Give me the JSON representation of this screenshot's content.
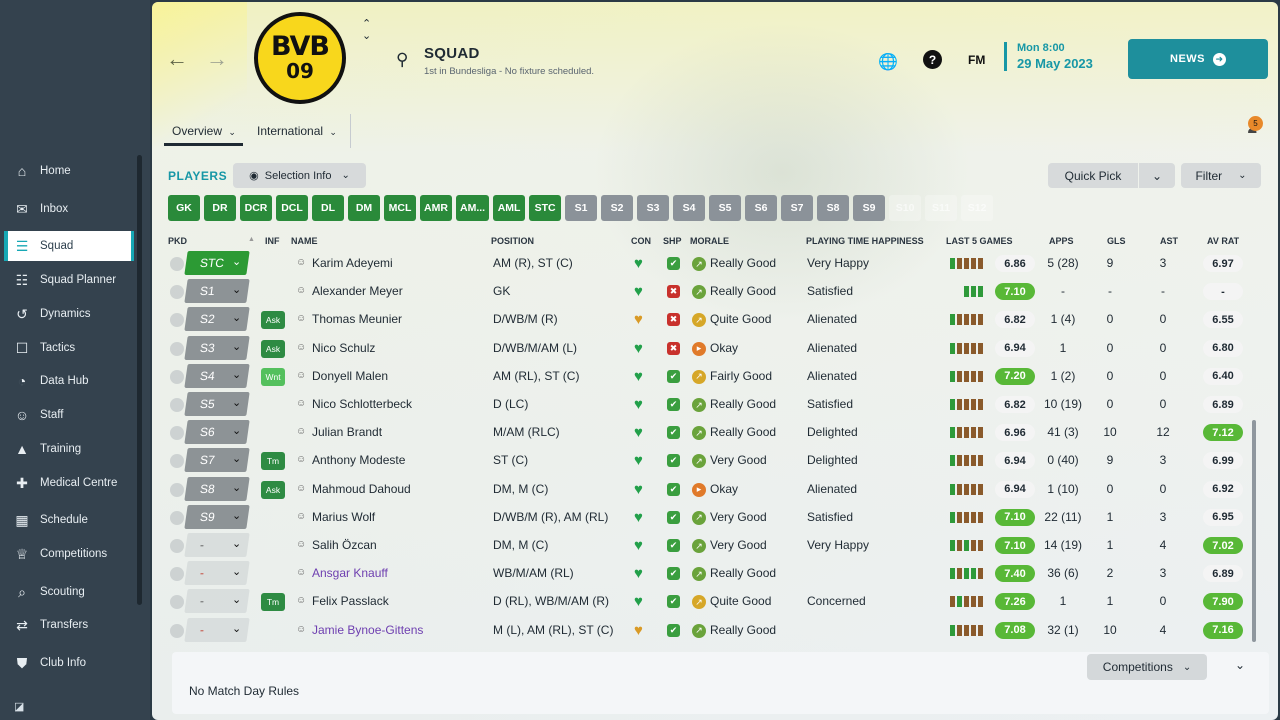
{
  "sidebar": {
    "items": [
      {
        "label": "Home",
        "icon": "home-icon"
      },
      {
        "label": "Inbox",
        "icon": "inbox-icon"
      },
      {
        "label": "Squad",
        "icon": "shirt-icon"
      },
      {
        "label": "Squad Planner",
        "icon": "clipboard-icon"
      },
      {
        "label": "Dynamics",
        "icon": "dynamics-icon"
      },
      {
        "label": "Tactics",
        "icon": "tactics-icon"
      },
      {
        "label": "Data Hub",
        "icon": "data-hub-icon"
      },
      {
        "label": "Staff",
        "icon": "staff-icon"
      },
      {
        "label": "Training",
        "icon": "training-icon"
      },
      {
        "label": "Medical Centre",
        "icon": "medical-icon"
      },
      {
        "label": "Schedule",
        "icon": "calendar-icon"
      },
      {
        "label": "Competitions",
        "icon": "trophy-icon"
      },
      {
        "label": "Scouting",
        "icon": "scouting-icon"
      },
      {
        "label": "Transfers",
        "icon": "transfers-icon"
      },
      {
        "label": "Club Info",
        "icon": "shield-icon"
      }
    ],
    "active": "Squad"
  },
  "header": {
    "crest_top": "BVB",
    "crest_bottom": "09",
    "title": "SQUAD",
    "subtitle": "1st in Bundesliga - No fixture scheduled.",
    "fm_logo": "FM",
    "date_day": "Mon 8:00",
    "date_full": "29 May 2023",
    "news_label": "NEWS",
    "notification_count": "5"
  },
  "tabs": {
    "overview": "Overview",
    "international": "International"
  },
  "players_label": "PLAYERS",
  "selection_info_label": "Selection Info",
  "quick_pick_label": "Quick Pick",
  "filter_label": "Filter",
  "position_chips": [
    {
      "label": "GK",
      "state": "green"
    },
    {
      "label": "DR",
      "state": "green"
    },
    {
      "label": "DCR",
      "state": "green"
    },
    {
      "label": "DCL",
      "state": "green"
    },
    {
      "label": "DL",
      "state": "green"
    },
    {
      "label": "DM",
      "state": "green"
    },
    {
      "label": "MCL",
      "state": "green"
    },
    {
      "label": "AMR",
      "state": "green"
    },
    {
      "label": "AM...",
      "state": "green"
    },
    {
      "label": "AML",
      "state": "green"
    },
    {
      "label": "STC",
      "state": "green"
    },
    {
      "label": "S1",
      "state": "grey"
    },
    {
      "label": "S2",
      "state": "grey"
    },
    {
      "label": "S3",
      "state": "grey"
    },
    {
      "label": "S4",
      "state": "grey"
    },
    {
      "label": "S5",
      "state": "grey"
    },
    {
      "label": "S6",
      "state": "grey"
    },
    {
      "label": "S7",
      "state": "grey"
    },
    {
      "label": "S8",
      "state": "grey"
    },
    {
      "label": "S9",
      "state": "grey"
    },
    {
      "label": "S10",
      "state": "faded"
    },
    {
      "label": "S11",
      "state": "faded"
    },
    {
      "label": "S12",
      "state": "faded"
    }
  ],
  "columns": {
    "pkd": "PKD",
    "inf": "INF",
    "name": "NAME",
    "position": "POSITION",
    "con": "CON",
    "shp": "SHP",
    "morale": "MORALE",
    "happiness": "PLAYING TIME HAPPINESS",
    "last5": "LAST 5 GAMES",
    "apps": "APPS",
    "gls": "GLS",
    "ast": "AST",
    "avrat": "AV RAT"
  },
  "players": [
    {
      "pkd": "STC",
      "pkd_style": "green",
      "inf": "",
      "name": "Karim Adeyemi",
      "name_style": "",
      "position": "AM (R), ST (C)",
      "con": "green",
      "shp": "green",
      "morale": "Really Good",
      "morale_style": "good",
      "happiness": "Very Happy",
      "form": [
        "g",
        "b",
        "b",
        "b",
        "b"
      ],
      "last5": "6.86",
      "last5_style": "",
      "apps": "5 (28)",
      "gls": "9",
      "ast": "3",
      "avrat": "6.97",
      "avrat_style": ""
    },
    {
      "pkd": "S1",
      "pkd_style": "grey",
      "inf": "",
      "name": "Alexander Meyer",
      "name_style": "",
      "position": "GK",
      "con": "green",
      "shp": "red",
      "morale": "Really Good",
      "morale_style": "good",
      "happiness": "Satisfied",
      "form": [
        "g",
        "g",
        "g"
      ],
      "last5": "7.10",
      "last5_style": "green",
      "apps": "-",
      "gls": "-",
      "ast": "-",
      "avrat": "-",
      "avrat_style": ""
    },
    {
      "pkd": "S2",
      "pkd_style": "grey",
      "inf": "Ask",
      "inf_style": "",
      "name": "Thomas Meunier",
      "name_style": "",
      "position": "D/WB/M (R)",
      "con": "orange",
      "shp": "red",
      "morale": "Quite Good",
      "morale_style": "yellow",
      "happiness": "Alienated",
      "form": [
        "g",
        "b",
        "b",
        "b",
        "b"
      ],
      "last5": "6.82",
      "last5_style": "",
      "apps": "1 (4)",
      "gls": "0",
      "ast": "0",
      "avrat": "6.55",
      "avrat_style": ""
    },
    {
      "pkd": "S3",
      "pkd_style": "grey",
      "inf": "Ask",
      "inf_style": "",
      "name": "Nico Schulz",
      "name_style": "",
      "position": "D/WB/M/AM (L)",
      "con": "green",
      "shp": "red",
      "morale": "Okay",
      "morale_style": "orange",
      "happiness": "Alienated",
      "form": [
        "g",
        "b",
        "b",
        "b",
        "b"
      ],
      "last5": "6.94",
      "last5_style": "",
      "apps": "1",
      "gls": "0",
      "ast": "0",
      "avrat": "6.80",
      "avrat_style": ""
    },
    {
      "pkd": "S4",
      "pkd_style": "grey",
      "inf": "Wnt",
      "inf_style": "light",
      "name": "Donyell Malen",
      "name_style": "",
      "position": "AM (RL), ST (C)",
      "con": "green",
      "shp": "green",
      "morale": "Fairly Good",
      "morale_style": "yellow",
      "happiness": "Alienated",
      "form": [
        "g",
        "b",
        "b",
        "b",
        "b"
      ],
      "last5": "7.20",
      "last5_style": "green",
      "apps": "1 (2)",
      "gls": "0",
      "ast": "0",
      "avrat": "6.40",
      "avrat_style": ""
    },
    {
      "pkd": "S5",
      "pkd_style": "grey",
      "inf": "",
      "name": "Nico Schlotterbeck",
      "name_style": "",
      "position": "D (LC)",
      "con": "green",
      "shp": "green",
      "morale": "Really Good",
      "morale_style": "good",
      "happiness": "Satisfied",
      "form": [
        "g",
        "b",
        "b",
        "b",
        "b"
      ],
      "last5": "6.82",
      "last5_style": "",
      "apps": "10 (19)",
      "gls": "0",
      "ast": "0",
      "avrat": "6.89",
      "avrat_style": ""
    },
    {
      "pkd": "S6",
      "pkd_style": "grey",
      "inf": "",
      "name": "Julian Brandt",
      "name_style": "",
      "position": "M/AM (RLC)",
      "con": "green",
      "shp": "green",
      "morale": "Really Good",
      "morale_style": "good",
      "happiness": "Delighted",
      "form": [
        "g",
        "b",
        "b",
        "b",
        "b"
      ],
      "last5": "6.96",
      "last5_style": "",
      "apps": "41 (3)",
      "gls": "10",
      "ast": "12",
      "avrat": "7.12",
      "avrat_style": "green"
    },
    {
      "pkd": "S7",
      "pkd_style": "grey",
      "inf": "Tm",
      "inf_style": "",
      "name": "Anthony Modeste",
      "name_style": "",
      "position": "ST (C)",
      "con": "green",
      "shp": "green",
      "morale": "Very Good",
      "morale_style": "good",
      "happiness": "Delighted",
      "form": [
        "g",
        "b",
        "b",
        "b",
        "b"
      ],
      "last5": "6.94",
      "last5_style": "",
      "apps": "0 (40)",
      "gls": "9",
      "ast": "3",
      "avrat": "6.99",
      "avrat_style": ""
    },
    {
      "pkd": "S8",
      "pkd_style": "grey",
      "inf": "Ask",
      "inf_style": "",
      "name": "Mahmoud Dahoud",
      "name_style": "",
      "position": "DM, M (C)",
      "con": "green",
      "shp": "green",
      "morale": "Okay",
      "morale_style": "orange",
      "happiness": "Alienated",
      "form": [
        "g",
        "b",
        "b",
        "b",
        "b"
      ],
      "last5": "6.94",
      "last5_style": "",
      "apps": "1 (10)",
      "gls": "0",
      "ast": "0",
      "avrat": "6.92",
      "avrat_style": ""
    },
    {
      "pkd": "S9",
      "pkd_style": "grey",
      "inf": "",
      "name": "Marius Wolf",
      "name_style": "",
      "position": "D/WB/M (R), AM (RL)",
      "con": "green",
      "shp": "green",
      "morale": "Very Good",
      "morale_style": "good",
      "happiness": "Satisfied",
      "form": [
        "g",
        "b",
        "b",
        "b",
        "b"
      ],
      "last5": "7.10",
      "last5_style": "green",
      "apps": "22 (11)",
      "gls": "1",
      "ast": "3",
      "avrat": "6.95",
      "avrat_style": ""
    },
    {
      "pkd": "-",
      "pkd_style": "empty",
      "inf": "",
      "name": "Salih Özcan",
      "name_style": "",
      "position": "DM, M (C)",
      "con": "green",
      "shp": "green",
      "morale": "Very Good",
      "morale_style": "good",
      "happiness": "Very Happy",
      "form": [
        "g",
        "b",
        "g",
        "b",
        "b"
      ],
      "last5": "7.10",
      "last5_style": "green",
      "apps": "14 (19)",
      "gls": "1",
      "ast": "4",
      "avrat": "7.02",
      "avrat_style": "green"
    },
    {
      "pkd": "-",
      "pkd_style": "empty red",
      "inf": "",
      "name": "Ansgar Knauff",
      "name_style": "purple",
      "position": "WB/M/AM (RL)",
      "con": "green",
      "shp": "green",
      "morale": "Really Good",
      "morale_style": "good",
      "happiness": "",
      "form": [
        "g",
        "b",
        "g",
        "g",
        "b"
      ],
      "last5": "7.40",
      "last5_style": "green",
      "apps": "36 (6)",
      "gls": "2",
      "ast": "3",
      "avrat": "6.89",
      "avrat_style": ""
    },
    {
      "pkd": "-",
      "pkd_style": "empty",
      "inf": "Tm",
      "inf_style": "",
      "name": "Felix Passlack",
      "name_style": "",
      "position": "D (RL), WB/M/AM (R)",
      "con": "green",
      "shp": "green",
      "morale": "Quite Good",
      "morale_style": "yellow",
      "happiness": "Concerned",
      "form": [
        "b",
        "g",
        "b",
        "b",
        "b"
      ],
      "last5": "7.26",
      "last5_style": "green",
      "apps": "1",
      "gls": "1",
      "ast": "0",
      "avrat": "7.90",
      "avrat_style": "green"
    },
    {
      "pkd": "-",
      "pkd_style": "empty red",
      "inf": "",
      "name": "Jamie Bynoe-Gittens",
      "name_style": "purple",
      "position": "M (L), AM (RL), ST (C)",
      "con": "orange",
      "shp": "green",
      "morale": "Really Good",
      "morale_style": "good",
      "happiness": "",
      "form": [
        "g",
        "b",
        "b",
        "b",
        "b"
      ],
      "last5": "7.08",
      "last5_style": "green",
      "apps": "32 (1)",
      "gls": "10",
      "ast": "4",
      "avrat": "7.16",
      "avrat_style": "green"
    }
  ],
  "footer": {
    "competitions_label": "Competitions",
    "match_day_rules": "No Match Day Rules"
  },
  "colors": {
    "accent": "#1797a6",
    "sidebar_bg": "#34424e",
    "chip_green": "#2a8a3a",
    "chip_grey": "#8b9299",
    "rating_green": "#58b837"
  }
}
